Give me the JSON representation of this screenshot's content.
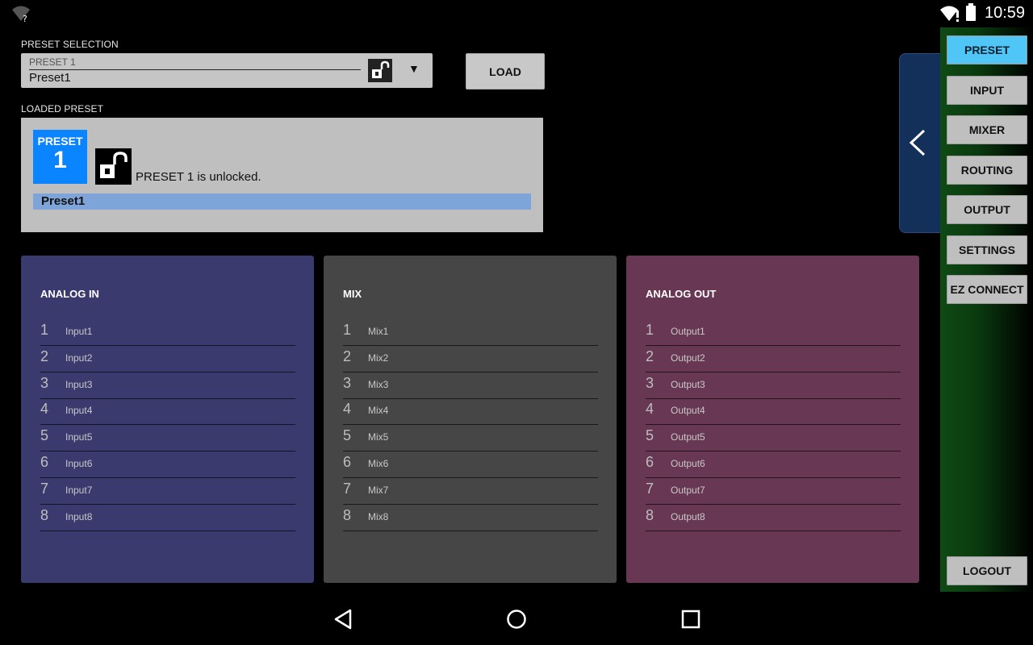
{
  "status_bar": {
    "time": "10:59"
  },
  "preset_selection": {
    "label": "PRESET SELECTION",
    "hint": "PRESET 1",
    "value": "Preset1",
    "load_label": "LOAD"
  },
  "loaded_preset": {
    "label": "LOADED PRESET",
    "badge_title": "PRESET",
    "badge_number": "1",
    "status_text": "PRESET 1 is unlocked.",
    "name": "Preset1"
  },
  "columns": [
    {
      "title": "ANALOG IN",
      "items": [
        {
          "n": "1",
          "name": "Input1"
        },
        {
          "n": "2",
          "name": "Input2"
        },
        {
          "n": "3",
          "name": "Input3"
        },
        {
          "n": "4",
          "name": "Input4"
        },
        {
          "n": "5",
          "name": "Input5"
        },
        {
          "n": "6",
          "name": "Input6"
        },
        {
          "n": "7",
          "name": "Input7"
        },
        {
          "n": "8",
          "name": "Input8"
        }
      ]
    },
    {
      "title": "MIX",
      "items": [
        {
          "n": "1",
          "name": "Mix1"
        },
        {
          "n": "2",
          "name": "Mix2"
        },
        {
          "n": "3",
          "name": "Mix3"
        },
        {
          "n": "4",
          "name": "Mix4"
        },
        {
          "n": "5",
          "name": "Mix5"
        },
        {
          "n": "6",
          "name": "Mix6"
        },
        {
          "n": "7",
          "name": "Mix7"
        },
        {
          "n": "8",
          "name": "Mix8"
        }
      ]
    },
    {
      "title": "ANALOG OUT",
      "items": [
        {
          "n": "1",
          "name": "Output1"
        },
        {
          "n": "2",
          "name": "Output2"
        },
        {
          "n": "3",
          "name": "Output3"
        },
        {
          "n": "4",
          "name": "Output4"
        },
        {
          "n": "5",
          "name": "Output5"
        },
        {
          "n": "6",
          "name": "Output6"
        },
        {
          "n": "7",
          "name": "Output7"
        },
        {
          "n": "8",
          "name": "Output8"
        }
      ]
    }
  ],
  "nav": {
    "items": [
      "PRESET",
      "INPUT",
      "MIXER",
      "ROUTING",
      "OUTPUT",
      "SETTINGS",
      "EZ CONNECT"
    ],
    "active": "PRESET",
    "logout": "LOGOUT"
  },
  "colors": {
    "accent_active": "#4fc6f5",
    "badge_blue": "#0a84ff",
    "analog_in_bg": "#3b3a6f",
    "mix_bg": "#464646",
    "analog_out_bg": "#683753"
  }
}
